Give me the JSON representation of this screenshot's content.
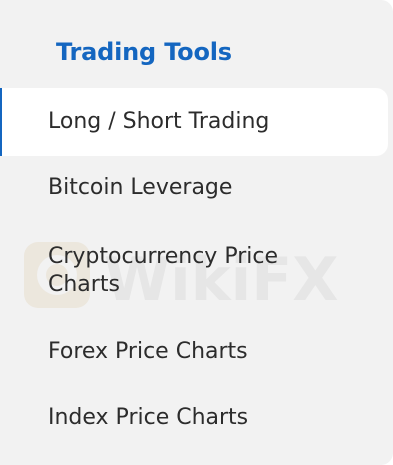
{
  "sidebar": {
    "title": "Trading Tools",
    "items": [
      {
        "label": "Long / Short Trading",
        "active": true
      },
      {
        "label": "Bitcoin Leverage",
        "active": false
      },
      {
        "label": "Cryptocurrency Price Charts",
        "active": false
      },
      {
        "label": "Forex Price Charts",
        "active": false
      },
      {
        "label": "Index Price Charts",
        "active": false
      }
    ]
  },
  "watermark": {
    "text": "WikiFX"
  },
  "colors": {
    "accent": "#1466c0",
    "panel_bg": "#f2f2f2",
    "active_bg": "#ffffff",
    "text": "#2c2c2c"
  }
}
